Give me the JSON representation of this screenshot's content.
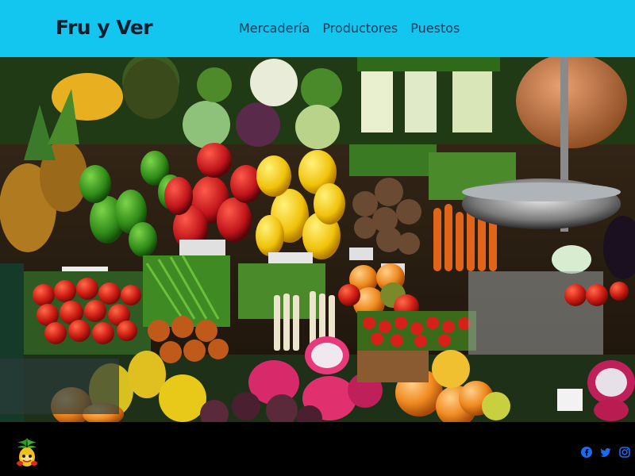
{
  "header": {
    "brand": "Fru y Ver",
    "nav": [
      "Mercadería",
      "Productores",
      "Puestos"
    ]
  },
  "hero": {
    "description_icons": [
      "fruit-vegetable-market-image"
    ]
  },
  "footer": {
    "logo_icon": "fruit-logo-icon",
    "social_icons": [
      "facebook-icon",
      "twitter-icon",
      "instagram-icon"
    ],
    "social_color": "#1d6af2"
  },
  "colors": {
    "header_bg": "#13c6ef",
    "brand_text": "#0b1f30",
    "nav_text": "#0f3a58",
    "footer_bg": "#000000"
  }
}
